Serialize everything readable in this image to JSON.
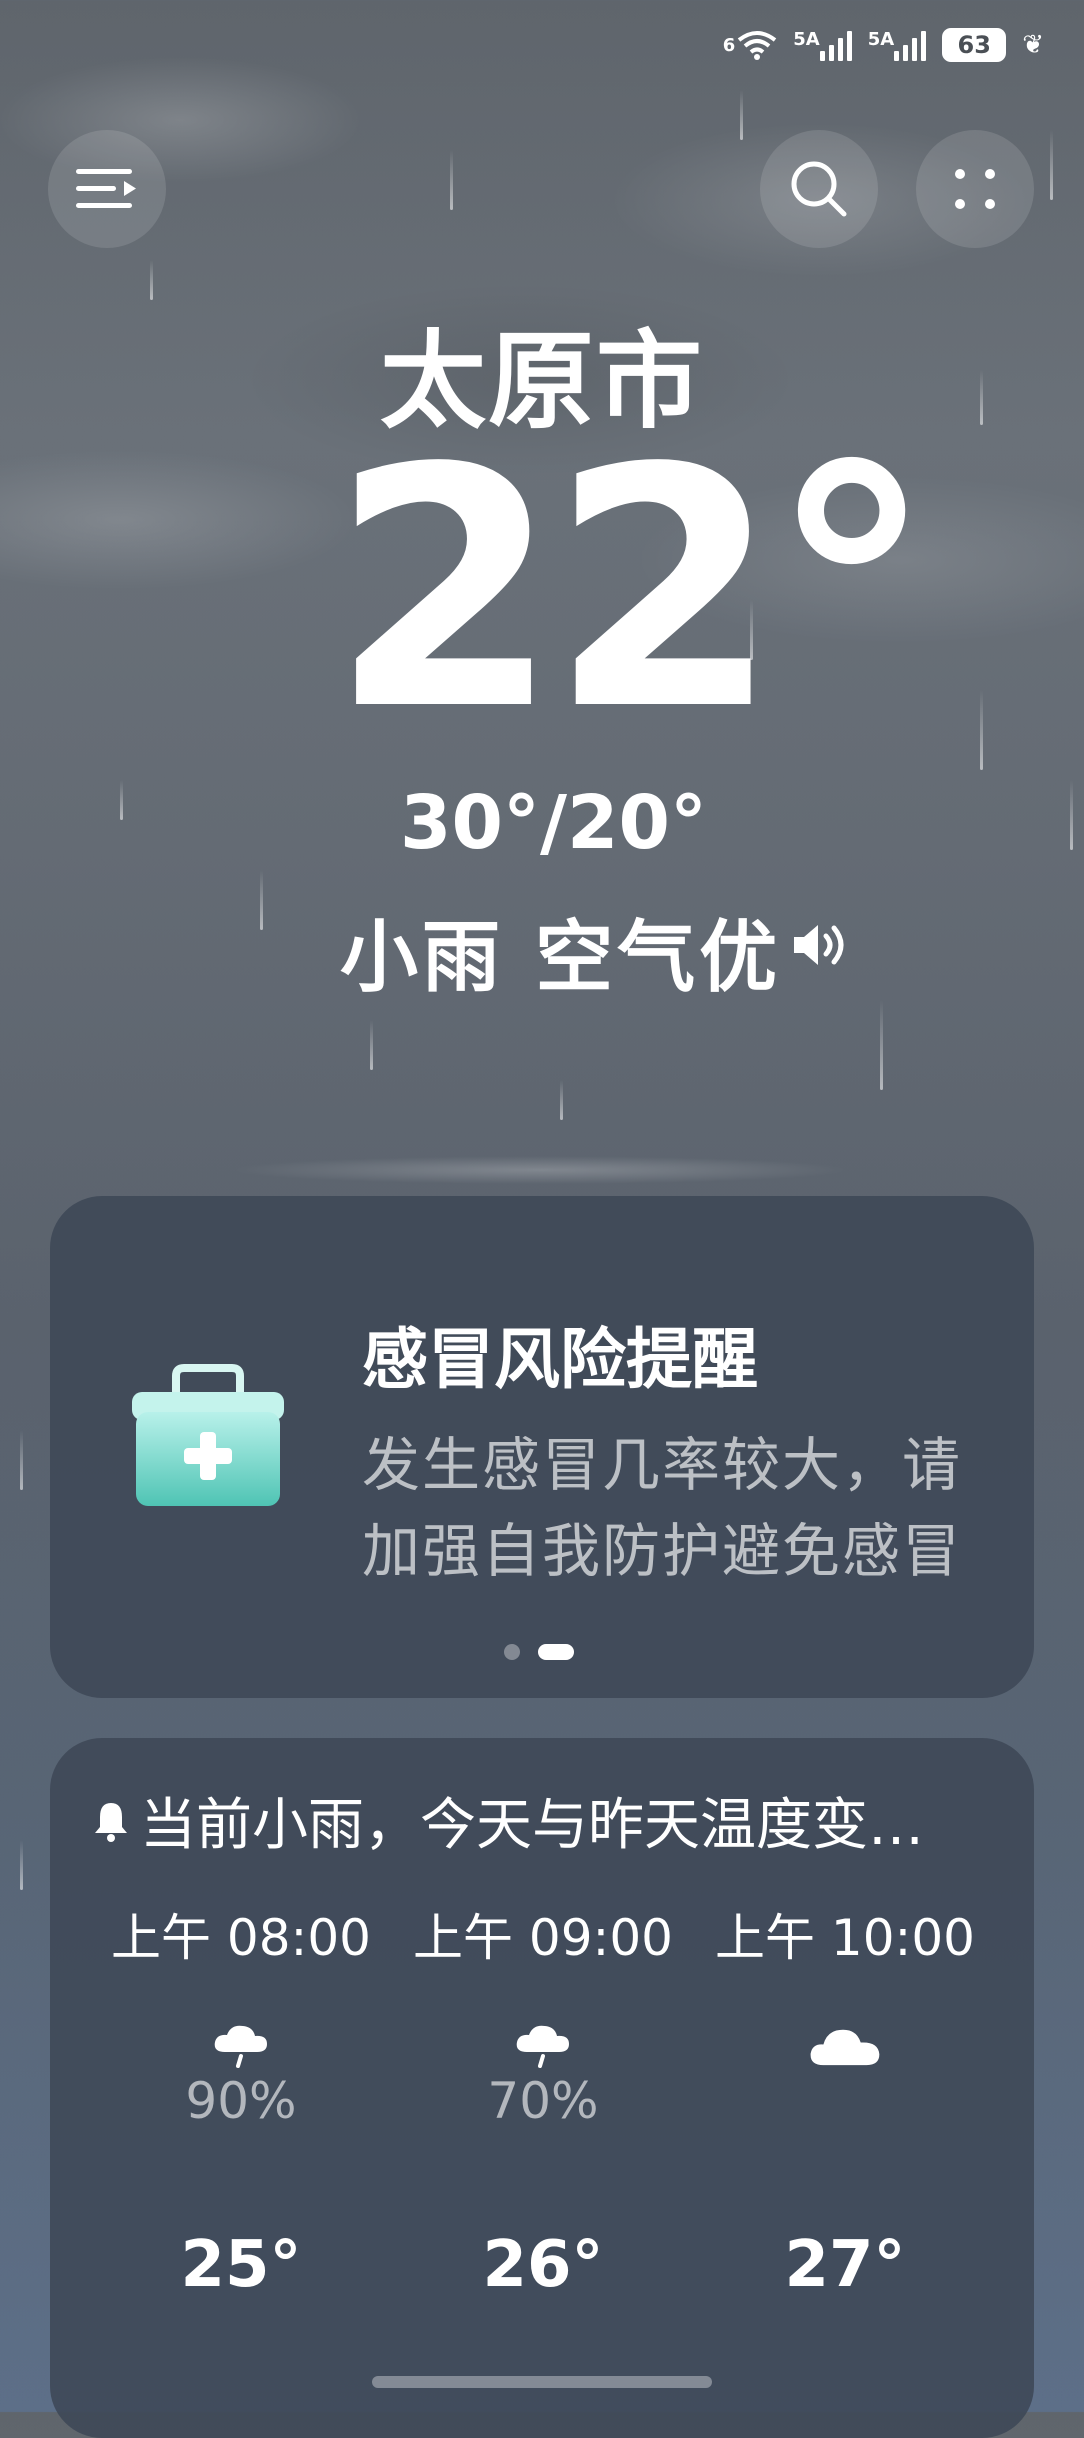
{
  "status": {
    "wifi_label": "6",
    "sim1_label": "5A",
    "sim2_label": "5A",
    "battery": "63"
  },
  "header": {
    "menu_icon": "menu-icon",
    "search_icon": "search-icon",
    "more_icon": "grid-dots-icon"
  },
  "weather": {
    "city": "太原市",
    "temperature": "22°",
    "high_low": "30°/20°",
    "condition": "小雨 空气优"
  },
  "risk_card": {
    "icon": "medical-kit-icon",
    "title": "感冒风险提醒",
    "line1": "发生感冒几率较大，请",
    "line2": "加强自我防护避免感冒"
  },
  "forecast": {
    "alert": "当前小雨，今天与昨天温度变…",
    "hours": [
      {
        "time": "上午 08:00",
        "icon": "light-rain-icon",
        "pop": "90%",
        "temp": "25°"
      },
      {
        "time": "上午 09:00",
        "icon": "light-rain-icon",
        "pop": "70%",
        "temp": "26°"
      },
      {
        "time": "上午 10:00",
        "icon": "cloudy-icon",
        "pop": "",
        "temp": "27°"
      }
    ]
  },
  "colors": {
    "kit_top": "#b8f1ea",
    "kit_bottom": "#4fc4b4"
  }
}
